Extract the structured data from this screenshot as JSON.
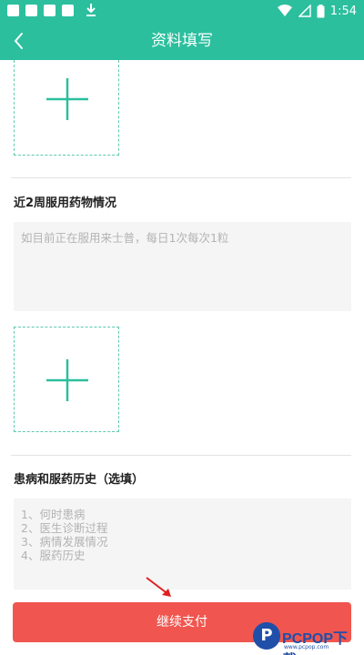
{
  "status_bar": {
    "time": "1:54"
  },
  "header": {
    "title": "资料填写"
  },
  "form": {
    "medication_section": {
      "label": "近2周服用药物情况",
      "placeholder": "如目前正在服用来士普，每日1次每次1粒"
    },
    "history_section": {
      "label": "患病和服药历史（选填）",
      "placeholder_lines": [
        "1、何时患病",
        "2、医生诊断过程",
        "3、病情发展情况",
        "4、服药历史"
      ]
    }
  },
  "footer": {
    "pay_label": "继续支付"
  },
  "watermark": {
    "brand": "PCPOP下载",
    "logo_letter": "P",
    "sub": "www.pcpop.com"
  },
  "colors": {
    "primary": "#2bbf9e",
    "accent": "#f0564f",
    "placeholder": "#b3b3b3"
  },
  "icons": [
    "back-arrow-icon",
    "add-image-plus-icon",
    "pointer-arrow-icon",
    "wifi-icon",
    "signal-icon",
    "battery-icon",
    "download-icon"
  ]
}
